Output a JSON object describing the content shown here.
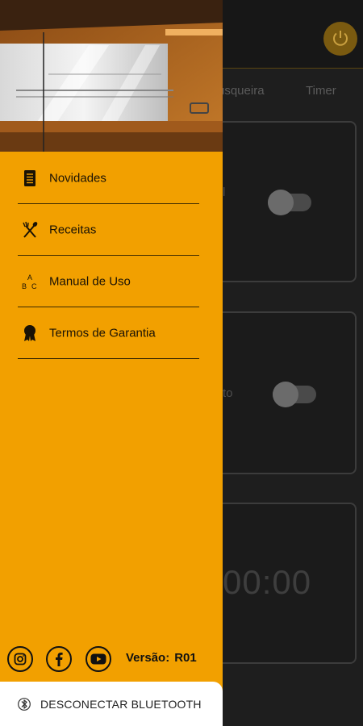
{
  "background_app": {
    "tabs": [
      "usqueira",
      "Timer"
    ],
    "card1_fragment": "l",
    "card2_fragment": "to",
    "timer_display": "00:00"
  },
  "drawer": {
    "menu": [
      {
        "label": "Novidades",
        "icon": "news-icon"
      },
      {
        "label": "Receitas",
        "icon": "fork-spoon-icon"
      },
      {
        "label": "Manual de Uso",
        "icon": "abc-icon"
      },
      {
        "label": "Termos de Garantia",
        "icon": "award-ribbon-icon"
      }
    ],
    "social": [
      "instagram-icon",
      "facebook-icon",
      "youtube-icon"
    ],
    "version_label": "Versão:",
    "version_value": "R01",
    "disconnect_label": "DESCONECTAR BLUETOOTH"
  },
  "colors": {
    "drawer_bg": "#f2a000",
    "accent_dim": "#7a5a10",
    "dark_bg": "#1e1e1e"
  }
}
